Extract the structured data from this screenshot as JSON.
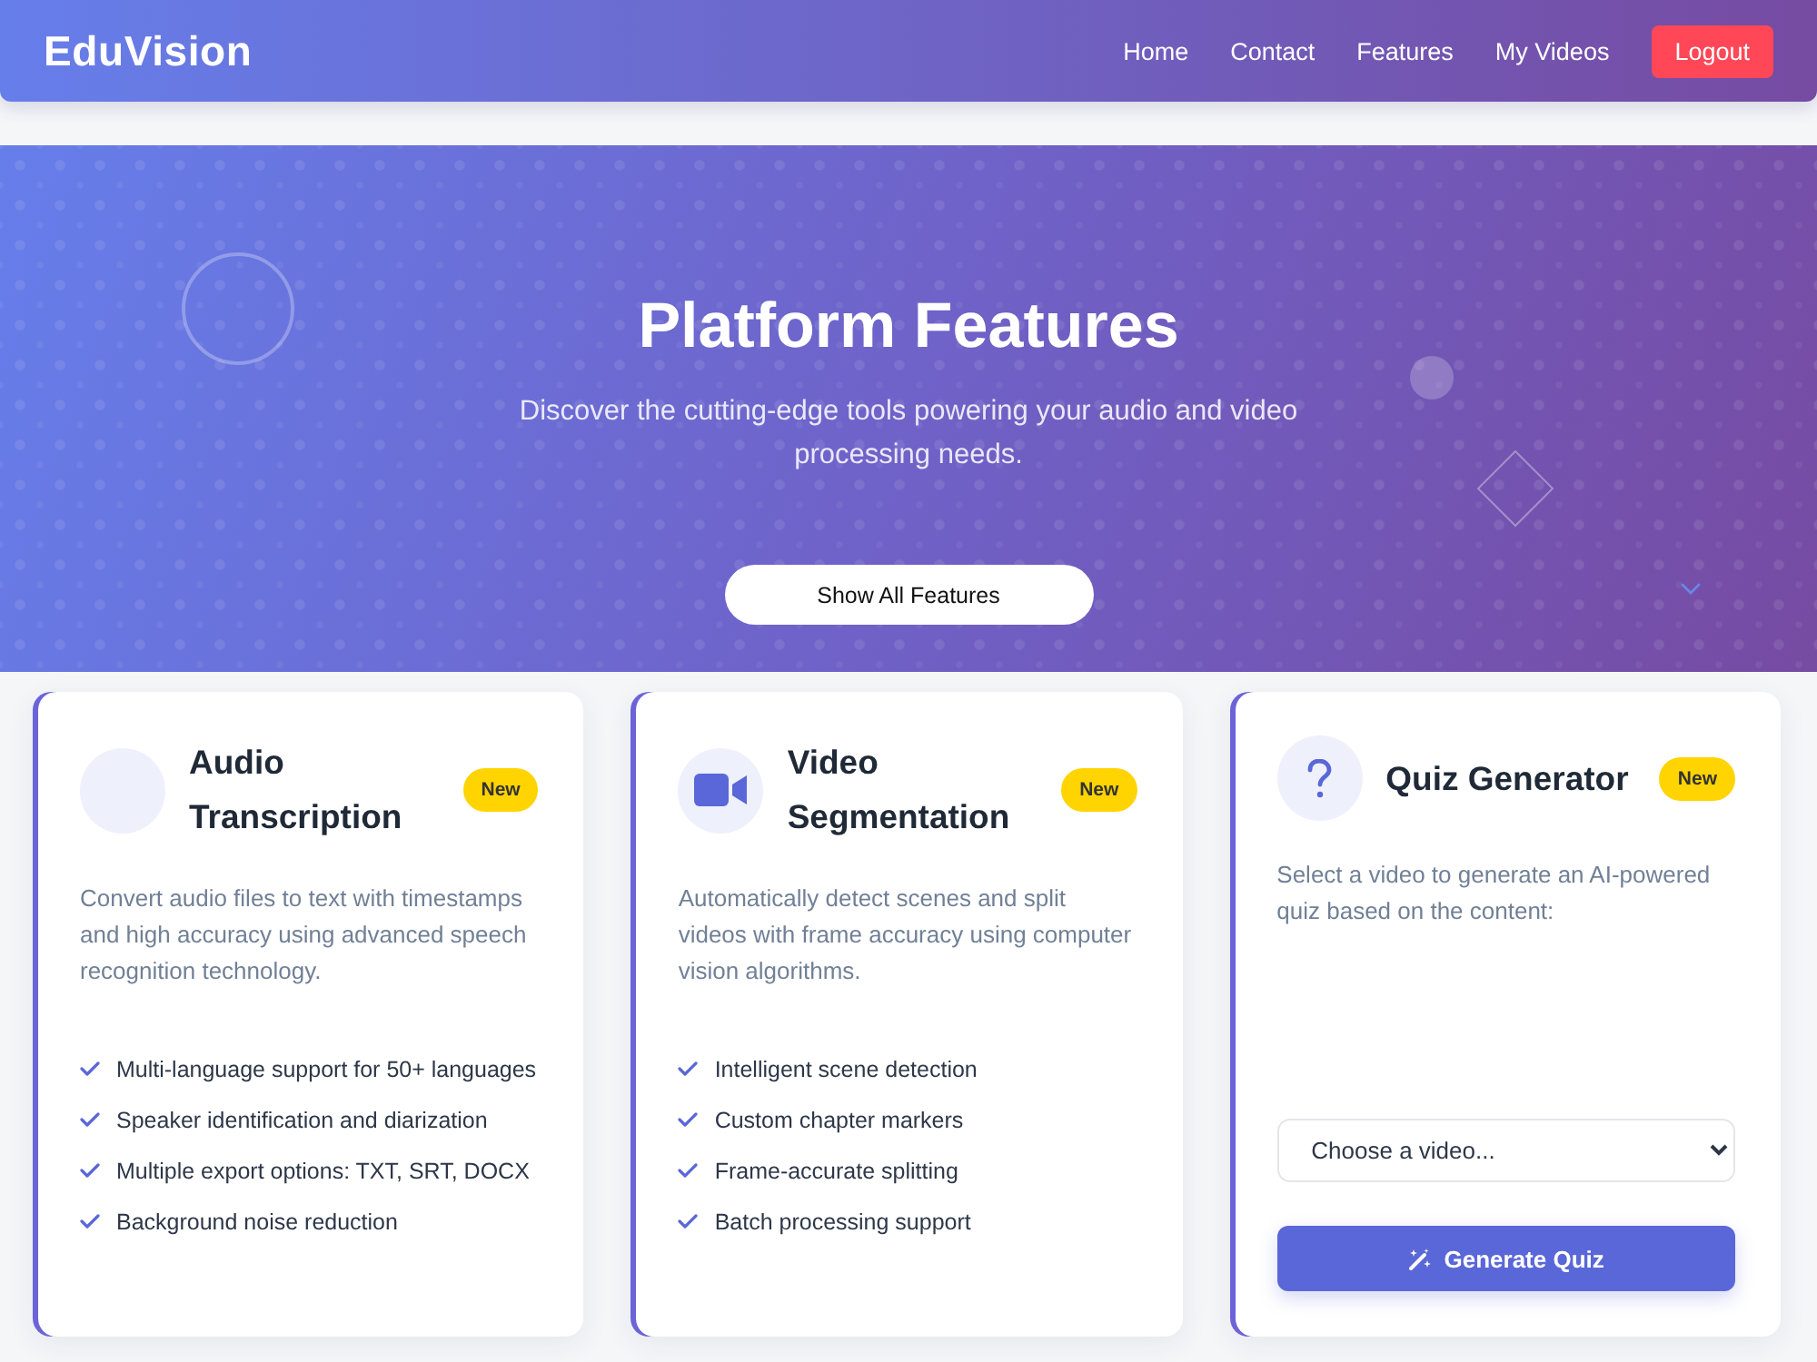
{
  "header": {
    "logo": "EduVision",
    "nav": [
      {
        "label": "Home",
        "kind": "link"
      },
      {
        "label": "Contact",
        "kind": "link"
      },
      {
        "label": "Features",
        "kind": "link"
      },
      {
        "label": "My Videos",
        "kind": "link"
      },
      {
        "label": "Logout",
        "kind": "button"
      }
    ]
  },
  "hero": {
    "title": "Platform Features",
    "subtitle": "Discover the cutting-edge tools powering your audio and video processing needs.",
    "button": "Show All Features"
  },
  "cards": [
    {
      "kind": "features",
      "title": "Audio Transcription",
      "badge": "New",
      "description": "Convert audio files to text with timestamps and high accuracy using advanced speech recognition technology.",
      "features": [
        "Multi-language support for 50+ languages",
        "Speaker identification and diarization",
        "Multiple export options: TXT, SRT, DOCX",
        "Background noise reduction"
      ]
    },
    {
      "kind": "features",
      "title": "Video Segmentation",
      "badge": "New",
      "description": "Automatically detect scenes and split videos with frame accuracy using computer vision algorithms.",
      "features": [
        "Intelligent scene detection",
        "Custom chapter markers",
        "Frame-accurate splitting",
        "Batch processing support"
      ]
    },
    {
      "kind": "quiz",
      "title": "Quiz Generator",
      "badge": "New",
      "description": "Select a video to generate an AI-powered quiz based on the content:",
      "select": {
        "value": "Choose a video..."
      },
      "button": "Generate Quiz"
    }
  ]
}
